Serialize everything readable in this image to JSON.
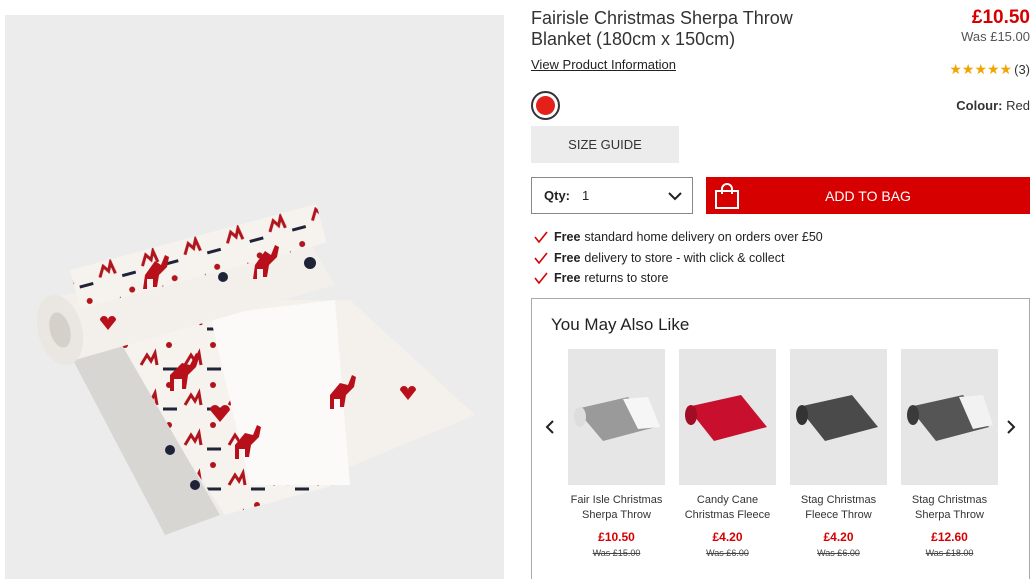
{
  "product": {
    "title": "Fairisle Christmas Sherpa Throw Blanket (180cm x 150cm)",
    "price": "£10.50",
    "was_price": "Was £15.00",
    "view_info_link": "View Product Information",
    "rating_stars": "★★★★★",
    "rating_count": "(3)",
    "colour_label": "Colour:",
    "colour_value": "Red",
    "swatch_color": "#e4201b",
    "size_guide_label": "SIZE GUIDE",
    "qty_label": "Qty:",
    "qty_value": "1",
    "add_to_bag_label": "ADD TO BAG"
  },
  "benefits": [
    {
      "bold": "Free",
      "text": "standard home delivery on orders over £50"
    },
    {
      "bold": "Free",
      "text": "delivery to store - with click & collect"
    },
    {
      "bold": "Free",
      "text": "returns to store"
    }
  ],
  "ymal": {
    "title": "You May Also Like",
    "items": [
      {
        "name": "Fair Isle Christmas Sherpa Throw",
        "price": "£10.50",
        "was": "Was £15.00",
        "color": "#9a9a9a"
      },
      {
        "name": "Candy Cane Christmas Fleece",
        "price": "£4.20",
        "was": "Was £6.00",
        "color": "#c8102e"
      },
      {
        "name": "Stag Christmas Fleece Throw",
        "price": "£4.20",
        "was": "Was £6.00",
        "color": "#4a4a4a"
      },
      {
        "name": "Stag Christmas Sherpa Throw",
        "price": "£12.60",
        "was": "Was £18.00",
        "color": "#555555"
      }
    ]
  },
  "colors": {
    "accent": "#d70000"
  }
}
